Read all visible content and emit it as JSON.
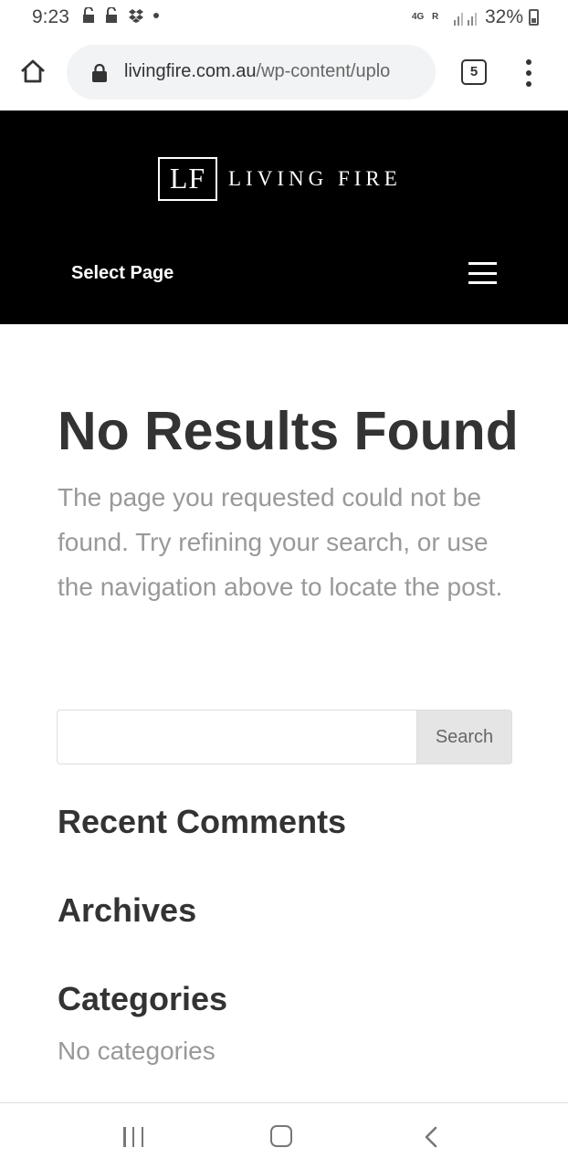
{
  "status_bar": {
    "time": "9:23",
    "icons": [
      "lock-open-icon",
      "lock-open-icon",
      "dropbox-icon",
      "dot-icon"
    ],
    "network": "4G",
    "roaming": "R",
    "battery": "32%"
  },
  "browser": {
    "url_host": "livingfire.com.au",
    "url_path": "/wp-content/uplo",
    "tab_count": "5"
  },
  "header": {
    "logo_mark": "LF",
    "logo_text": "LIVING FIRE",
    "nav_label": "Select Page"
  },
  "main": {
    "title": "No Results Found",
    "message": "The page you requested could not be found. Try refining your search, or use the navigation above to locate the post.",
    "search": {
      "placeholder": "",
      "button_label": "Search"
    },
    "widgets": {
      "recent_comments": "Recent Comments",
      "archives": "Archives",
      "categories": "Categories",
      "no_categories": "No categories"
    }
  },
  "colors": {
    "header_bg": "#000000",
    "title": "#333333",
    "muted_text": "#999999",
    "search_button_bg": "#e5e5e5"
  }
}
